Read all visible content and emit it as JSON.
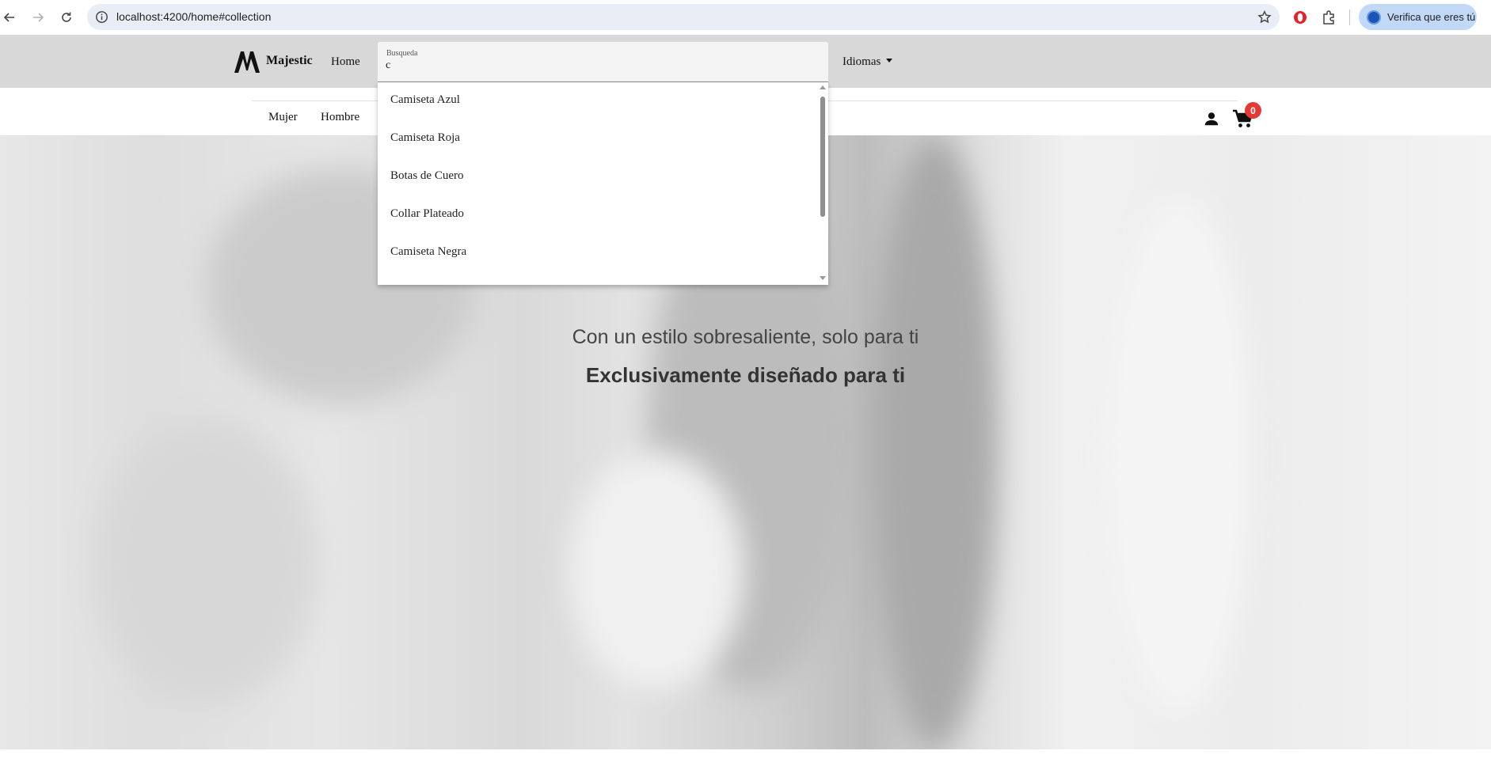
{
  "browser": {
    "url": "localhost:4200/home#collection",
    "profile_label": "Verifica que eres tú"
  },
  "header": {
    "brand": "Majestic",
    "nav_home": "Home",
    "languages": "Idiomas"
  },
  "search": {
    "label": "Busqueda",
    "value": "c",
    "suggestions": [
      "Camiseta Azul",
      "Camiseta Roja",
      "Botas de Cuero",
      "Collar Plateado",
      "Camiseta Negra"
    ]
  },
  "categories": [
    "Mujer",
    "Hombre"
  ],
  "cart": {
    "count": "0"
  },
  "hero": {
    "tagline": "Con un estilo sobresaliente, solo para ti",
    "headline": "Exclusivamente diseñado para ti"
  }
}
